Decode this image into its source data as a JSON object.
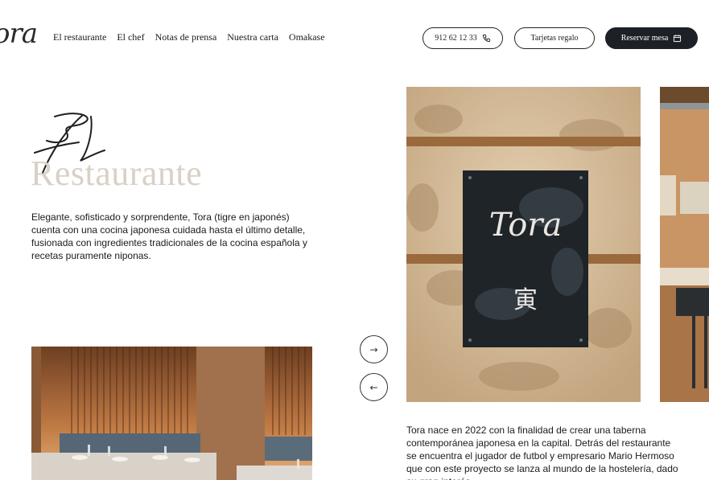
{
  "header": {
    "logo": "ora",
    "nav": [
      "El restaurante",
      "El chef",
      "Notas de prensa",
      "Nuestra carta",
      "Omakase"
    ],
    "phone": "912 62 12 33",
    "gift": "Tarjetas regalo",
    "reserve": "Reservar mesa"
  },
  "hero": {
    "script_word": "El",
    "title": "Restaurante",
    "intro": "Elegante, sofisticado y sorprendente, Tora (tigre en japonés) cuenta con una cocina japonesa cuidada hasta el último detalle, fusionada con ingredientes tradicionales de la cocina española y recetas puramente niponas."
  },
  "slider": {
    "next_arrow": "→",
    "prev_arrow": "←",
    "sign_text": "Tora",
    "sign_kanji": "寅"
  },
  "description": "Tora nace en 2022 con la finalidad de crear una taberna contemporánea japonesa en la capital. Detrás del restaurante se encuentra el jugador de futbol y empresario Mario Hermoso que con este proyecto se lanza al mundo de la hostelería, dado su gran interés",
  "colors": {
    "title_beige": "#d9d1c6",
    "dark_button": "#1d2026",
    "wall_beige": "#cdb494"
  }
}
